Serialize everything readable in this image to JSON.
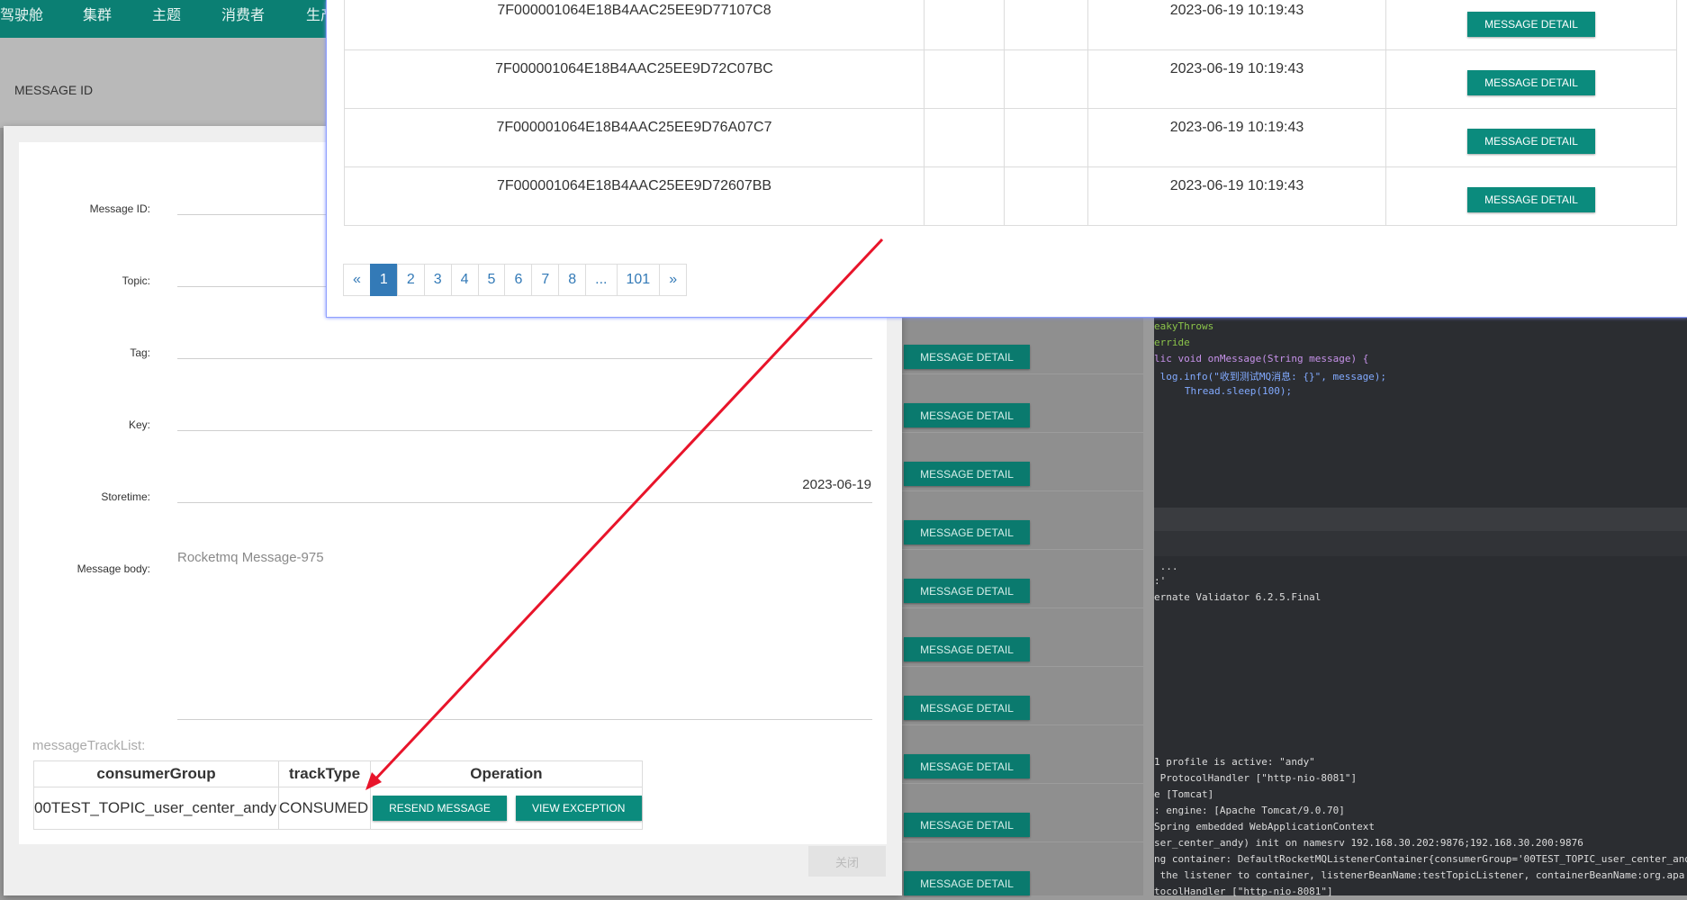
{
  "nav": {
    "items": [
      "驾驶舱",
      "集群",
      "主题",
      "消费者",
      "生产"
    ]
  },
  "background": {
    "message_id_label": "MESSAGE ID",
    "row_button_label": "MESSAGE DETAIL",
    "row_count": 10
  },
  "ide": {
    "code_lines": [
      "eakyThrows",
      "erride",
      "lic void onMessage(String message) {",
      " log.info(\"收到测试MQ消息: {}\", message);",
      "   Thread.sleep(100);"
    ],
    "console_lines": [
      " ...",
      ":'",
      "ernate Validator 6.2.5.Final",
      "1 profile is active: \"andy\"",
      " ProtocolHandler [\"http-nio-8081\"]",
      "e [Tomcat]",
      ": engine: [Apache Tomcat/9.0.70]",
      "Spring embedded WebApplicationContext",
      "ser_center_andy) init on namesrv 192.168.30.202:9876;192.168.30.200:9876",
      "ng container: DefaultRocketMQListenerContainer{consumerGroup='00TEST_TOPIC_user_center_and",
      " the listener to container, listenerBeanName:testTopicListener, containerBeanName:org.apa",
      "tocolHandler [\"http-nio-8081\"]"
    ]
  },
  "detail": {
    "labels": {
      "message_id": "Message ID:",
      "topic": "Topic:",
      "tag": "Tag:",
      "key": "Key:",
      "storetime": "Storetime:",
      "message_body": "Message body:"
    },
    "storetime_value": "2023-06-19",
    "message_body_value": "Rocketmq Message-975",
    "track_list_label": "messageTrackList:",
    "track_headers": [
      "consumerGroup",
      "trackType",
      "Operation"
    ],
    "track_rows": [
      {
        "consumer_group": "00TEST_TOPIC_user_center_andy",
        "track_type": "CONSUMED"
      }
    ],
    "resend_label": "RESEND MESSAGE",
    "view_exception_label": "VIEW EXCEPTION",
    "close_label": "关闭"
  },
  "messages": {
    "button_label": "MESSAGE DETAIL",
    "rows": [
      {
        "id": "7F000001064E18B4AAC25EE9D77107C8",
        "time": "2023-06-19 10:19:43"
      },
      {
        "id": "7F000001064E18B4AAC25EE9D72C07BC",
        "time": "2023-06-19 10:19:43"
      },
      {
        "id": "7F000001064E18B4AAC25EE9D76A07C7",
        "time": "2023-06-19 10:19:43"
      },
      {
        "id": "7F000001064E18B4AAC25EE9D72607BB",
        "time": "2023-06-19 10:19:43"
      }
    ]
  },
  "pagination": {
    "prev": "«",
    "pages": [
      "1",
      "2",
      "3",
      "4",
      "5",
      "6",
      "7",
      "8",
      "...",
      "101"
    ],
    "next": "»",
    "active": "1"
  },
  "colors": {
    "accent": "#0b8b7d",
    "pager_active": "#337ab7",
    "arrow": "#e8142a"
  }
}
